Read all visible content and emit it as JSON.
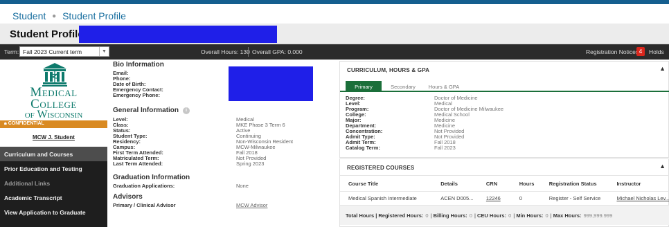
{
  "breadcrumb": {
    "root": "Student",
    "current": "Student Profile"
  },
  "page_title": "Student Profile -",
  "topbar": {
    "term_label": "Term:",
    "term_value": "Fall 2023 Current term",
    "overall_hours": "Overall Hours: 130",
    "overall_gpa": "Overall GPA: 0.000",
    "notices_label": "Registration Notices",
    "notices_count": "4",
    "holds_label": "Holds"
  },
  "logo": {
    "line1": "Medical",
    "line2": "College",
    "line3": "of Wisconsin"
  },
  "sidebar": {
    "confidential": "CONFIDENTIAL",
    "student_name": "MCW J. Student",
    "items": [
      {
        "label": "Curriculum and Courses"
      },
      {
        "label": "Prior Education and Testing"
      },
      {
        "label": "Additional Links"
      },
      {
        "label": "Academic Transcript"
      },
      {
        "label": "View Application to Graduate"
      }
    ]
  },
  "bio": {
    "heading": "Bio Information",
    "labels": [
      "Email:",
      "Phone:",
      "Date of Birth:",
      "Emergency Contact:",
      "Emergency Phone:"
    ]
  },
  "general": {
    "heading": "General Information",
    "rows": [
      {
        "label": "Level:",
        "value": "Medical"
      },
      {
        "label": "Class:",
        "value": "MKE Phase 3 Term 6"
      },
      {
        "label": "Status:",
        "value": "Active"
      },
      {
        "label": "Student Type:",
        "value": "Continuing"
      },
      {
        "label": "Residency:",
        "value": "Non-Wisconsin Resident"
      },
      {
        "label": "Campus:",
        "value": "MCW-Milwaukee"
      },
      {
        "label": "First Term Attended:",
        "value": "Fall 2018"
      },
      {
        "label": "Matriculated Term:",
        "value": "Not Provided"
      },
      {
        "label": "Last Term Attended:",
        "value": "Spring 2023"
      }
    ]
  },
  "graduation": {
    "heading": "Graduation Information",
    "label": "Graduation Applications:",
    "value": "None"
  },
  "advisors": {
    "heading": "Advisors",
    "label": "Primary / Clinical Advisor",
    "value": "MCW Advisor"
  },
  "curriculum": {
    "heading": "CURRICULUM, HOURS & GPA",
    "tabs": [
      "Primary",
      "Secondary",
      "Hours & GPA"
    ],
    "rows": [
      {
        "label": "Degree:",
        "value": "Doctor of Medicine"
      },
      {
        "label": "Level:",
        "value": "Medical"
      },
      {
        "label": "Program:",
        "value": "Doctor of Medicine Milwaukee"
      },
      {
        "label": "College:",
        "value": "Medical School"
      },
      {
        "label": "Major:",
        "value": "Medicine"
      },
      {
        "label": "Department:",
        "value": "Medicine"
      },
      {
        "label": "Concentration:",
        "value": "Not Provided"
      },
      {
        "label": "Admit Type:",
        "value": "Not Provided"
      },
      {
        "label": "Admit Term:",
        "value": "Fall 2018"
      },
      {
        "label": "Catalog Term:",
        "value": "Fall 2023"
      }
    ]
  },
  "registered": {
    "heading": "REGISTERED COURSES",
    "columns": [
      "Course Title",
      "Details",
      "CRN",
      "Hours",
      "Registration Status",
      "Instructor"
    ],
    "rows": [
      {
        "title": "Medical Spanish Intermediate",
        "details": "ACEN D005...",
        "crn": "12246",
        "hours": "0",
        "status": "Register - Self Service",
        "instructor": "Michael Nicholas Lev..."
      }
    ],
    "totals": {
      "total_label": "Total Hours |",
      "registered_label": "Registered Hours:",
      "registered_value": "0",
      "billing_label": "Billing Hours:",
      "billing_value": "0",
      "ceu_label": "CEU Hours:",
      "ceu_value": "0",
      "min_label": "Min Hours:",
      "min_value": "0",
      "max_label": "Max Hours:",
      "max_value": "999,999.999"
    }
  }
}
